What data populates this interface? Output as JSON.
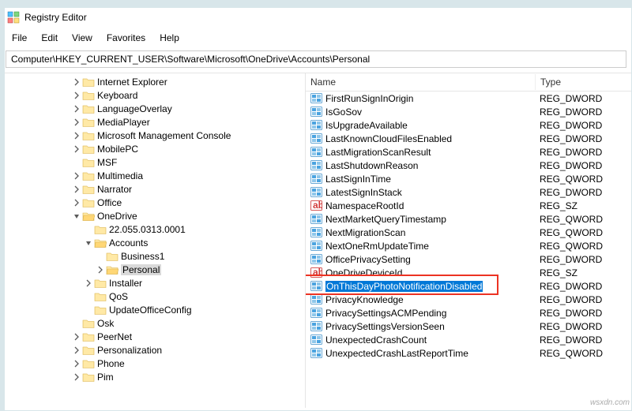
{
  "window": {
    "title": "Registry Editor"
  },
  "menu": {
    "items": [
      "File",
      "Edit",
      "View",
      "Favorites",
      "Help"
    ]
  },
  "path": "Computer\\HKEY_CURRENT_USER\\Software\\Microsoft\\OneDrive\\Accounts\\Personal",
  "tree": [
    {
      "indent": 6,
      "expand": "closed",
      "open": false,
      "label": "Internet Explorer"
    },
    {
      "indent": 6,
      "expand": "closed",
      "open": false,
      "label": "Keyboard"
    },
    {
      "indent": 6,
      "expand": "closed",
      "open": false,
      "label": "LanguageOverlay"
    },
    {
      "indent": 6,
      "expand": "closed",
      "open": false,
      "label": "MediaPlayer"
    },
    {
      "indent": 6,
      "expand": "closed",
      "open": false,
      "label": "Microsoft Management Console"
    },
    {
      "indent": 6,
      "expand": "closed",
      "open": false,
      "label": "MobilePC"
    },
    {
      "indent": 6,
      "expand": "none",
      "open": false,
      "label": "MSF"
    },
    {
      "indent": 6,
      "expand": "closed",
      "open": false,
      "label": "Multimedia"
    },
    {
      "indent": 6,
      "expand": "closed",
      "open": false,
      "label": "Narrator"
    },
    {
      "indent": 6,
      "expand": "closed",
      "open": false,
      "label": "Office"
    },
    {
      "indent": 6,
      "expand": "open",
      "open": true,
      "label": "OneDrive"
    },
    {
      "indent": 7,
      "expand": "none",
      "open": false,
      "label": "22.055.0313.0001"
    },
    {
      "indent": 7,
      "expand": "open",
      "open": true,
      "label": "Accounts"
    },
    {
      "indent": 8,
      "expand": "none",
      "open": false,
      "label": "Business1"
    },
    {
      "indent": 8,
      "expand": "closed",
      "open": true,
      "label": "Personal",
      "selected": true
    },
    {
      "indent": 7,
      "expand": "closed",
      "open": false,
      "label": "Installer"
    },
    {
      "indent": 7,
      "expand": "none",
      "open": false,
      "label": "QoS"
    },
    {
      "indent": 7,
      "expand": "none",
      "open": false,
      "label": "UpdateOfficeConfig"
    },
    {
      "indent": 6,
      "expand": "none",
      "open": false,
      "label": "Osk"
    },
    {
      "indent": 6,
      "expand": "closed",
      "open": false,
      "label": "PeerNet"
    },
    {
      "indent": 6,
      "expand": "closed",
      "open": false,
      "label": "Personalization"
    },
    {
      "indent": 6,
      "expand": "closed",
      "open": false,
      "label": "Phone"
    },
    {
      "indent": 6,
      "expand": "closed",
      "open": false,
      "label": "Pim"
    }
  ],
  "list": {
    "columns": {
      "name": "Name",
      "type": "Type"
    },
    "rows": [
      {
        "icon": "num",
        "name": "FirstRunSignInOrigin",
        "type": "REG_DWORD"
      },
      {
        "icon": "num",
        "name": "IsGoSov",
        "type": "REG_DWORD"
      },
      {
        "icon": "num",
        "name": "IsUpgradeAvailable",
        "type": "REG_DWORD"
      },
      {
        "icon": "num",
        "name": "LastKnownCloudFilesEnabled",
        "type": "REG_DWORD"
      },
      {
        "icon": "num",
        "name": "LastMigrationScanResult",
        "type": "REG_DWORD"
      },
      {
        "icon": "num",
        "name": "LastShutdownReason",
        "type": "REG_DWORD"
      },
      {
        "icon": "num",
        "name": "LastSignInTime",
        "type": "REG_QWORD"
      },
      {
        "icon": "num",
        "name": "LatestSignInStack",
        "type": "REG_DWORD"
      },
      {
        "icon": "str",
        "name": "NamespaceRootId",
        "type": "REG_SZ"
      },
      {
        "icon": "num",
        "name": "NextMarketQueryTimestamp",
        "type": "REG_QWORD"
      },
      {
        "icon": "num",
        "name": "NextMigrationScan",
        "type": "REG_QWORD"
      },
      {
        "icon": "num",
        "name": "NextOneRmUpdateTime",
        "type": "REG_QWORD"
      },
      {
        "icon": "num",
        "name": "OfficePrivacySetting",
        "type": "REG_DWORD"
      },
      {
        "icon": "str",
        "name": "OneDriveDeviceId",
        "type": "REG_SZ"
      },
      {
        "icon": "num",
        "name": "OnThisDayPhotoNotificationDisabled",
        "type": "REG_DWORD",
        "selected": true
      },
      {
        "icon": "num",
        "name": "PrivacyKnowledge",
        "type": "REG_DWORD"
      },
      {
        "icon": "num",
        "name": "PrivacySettingsACMPending",
        "type": "REG_DWORD"
      },
      {
        "icon": "num",
        "name": "PrivacySettingsVersionSeen",
        "type": "REG_DWORD"
      },
      {
        "icon": "num",
        "name": "UnexpectedCrashCount",
        "type": "REG_DWORD"
      },
      {
        "icon": "num",
        "name": "UnexpectedCrashLastReportTime",
        "type": "REG_QWORD"
      }
    ]
  },
  "watermark": "wsxdn.com"
}
